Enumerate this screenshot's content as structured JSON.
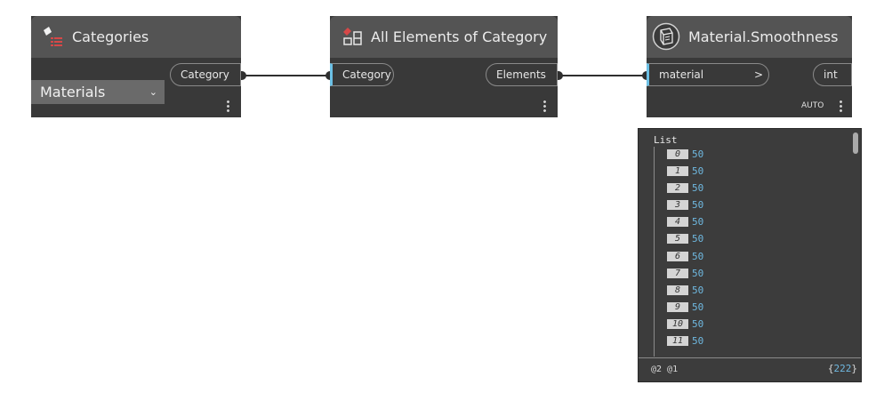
{
  "nodes": {
    "categories": {
      "title": "Categories",
      "dropdown_value": "Materials",
      "output_port": "Category"
    },
    "all_elements": {
      "title": "All Elements of Category",
      "input_port": "Category",
      "output_port": "Elements"
    },
    "smoothness": {
      "title": "Material.Smoothness",
      "input_port": "material",
      "input_arrow": ">",
      "output_port": "int",
      "lacing": "AUTO"
    }
  },
  "preview": {
    "header": "List",
    "items": [
      {
        "index": "0",
        "value": "50"
      },
      {
        "index": "1",
        "value": "50"
      },
      {
        "index": "2",
        "value": "50"
      },
      {
        "index": "3",
        "value": "50"
      },
      {
        "index": "4",
        "value": "50"
      },
      {
        "index": "5",
        "value": "50"
      },
      {
        "index": "6",
        "value": "50"
      },
      {
        "index": "7",
        "value": "50"
      },
      {
        "index": "8",
        "value": "50"
      },
      {
        "index": "9",
        "value": "50"
      },
      {
        "index": "10",
        "value": "50"
      },
      {
        "index": "11",
        "value": "50"
      }
    ],
    "levels": "@2 @1",
    "count_open": "{",
    "count": "222",
    "count_close": "}"
  }
}
